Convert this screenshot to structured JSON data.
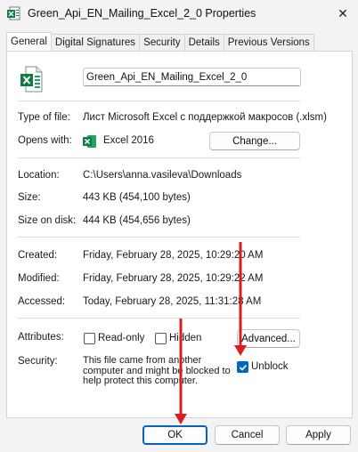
{
  "window": {
    "title": "Green_Api_EN_Mailing_Excel_2_0 Properties",
    "close_label": "✕"
  },
  "tabs": [
    {
      "label": "General"
    },
    {
      "label": "Digital Signatures"
    },
    {
      "label": "Security"
    },
    {
      "label": "Details"
    },
    {
      "label": "Previous Versions"
    }
  ],
  "general": {
    "file_name": "Green_Api_EN_Mailing_Excel_2_0",
    "type_of_file": {
      "label": "Type of file:",
      "value": "Лист Microsoft Excel с поддержкой макросов (.xlsm)"
    },
    "opens_with": {
      "label": "Opens with:",
      "value": "Excel 2016",
      "button": "Change..."
    },
    "location": {
      "label": "Location:",
      "value": "C:\\Users\\anna.vasileva\\Downloads"
    },
    "size": {
      "label": "Size:",
      "value": "443 KB (454,100 bytes)"
    },
    "size_on_disk": {
      "label": "Size on disk:",
      "value": "444 KB (454,656 bytes)"
    },
    "created": {
      "label": "Created:",
      "value": "Friday, February 28, 2025, 10:29:20 AM"
    },
    "modified": {
      "label": "Modified:",
      "value": "Friday, February 28, 2025, 10:29:22 AM"
    },
    "accessed": {
      "label": "Accessed:",
      "value": "Today, February 28, 2025, 11:31:28 AM"
    },
    "attributes": {
      "label": "Attributes:",
      "read_only": {
        "label": "Read-only",
        "checked": false
      },
      "hidden": {
        "label": "Hidden",
        "checked": false
      },
      "advanced_button": "Advanced..."
    },
    "security": {
      "label": "Security:",
      "text": "This file came from another computer and might be blocked to help protect this computer.",
      "unblock": {
        "label": "Unblock",
        "checked": true
      }
    }
  },
  "buttons": {
    "ok": "OK",
    "cancel": "Cancel",
    "apply": "Apply"
  },
  "colors": {
    "accent": "#0067c0",
    "excel_green": "#107c41",
    "annotation_arrow": "#d81e1e"
  },
  "icons": {
    "title": "excel-file-icon",
    "file": "excel-file-icon",
    "opens_with": "excel-app-icon",
    "close": "close-icon"
  }
}
